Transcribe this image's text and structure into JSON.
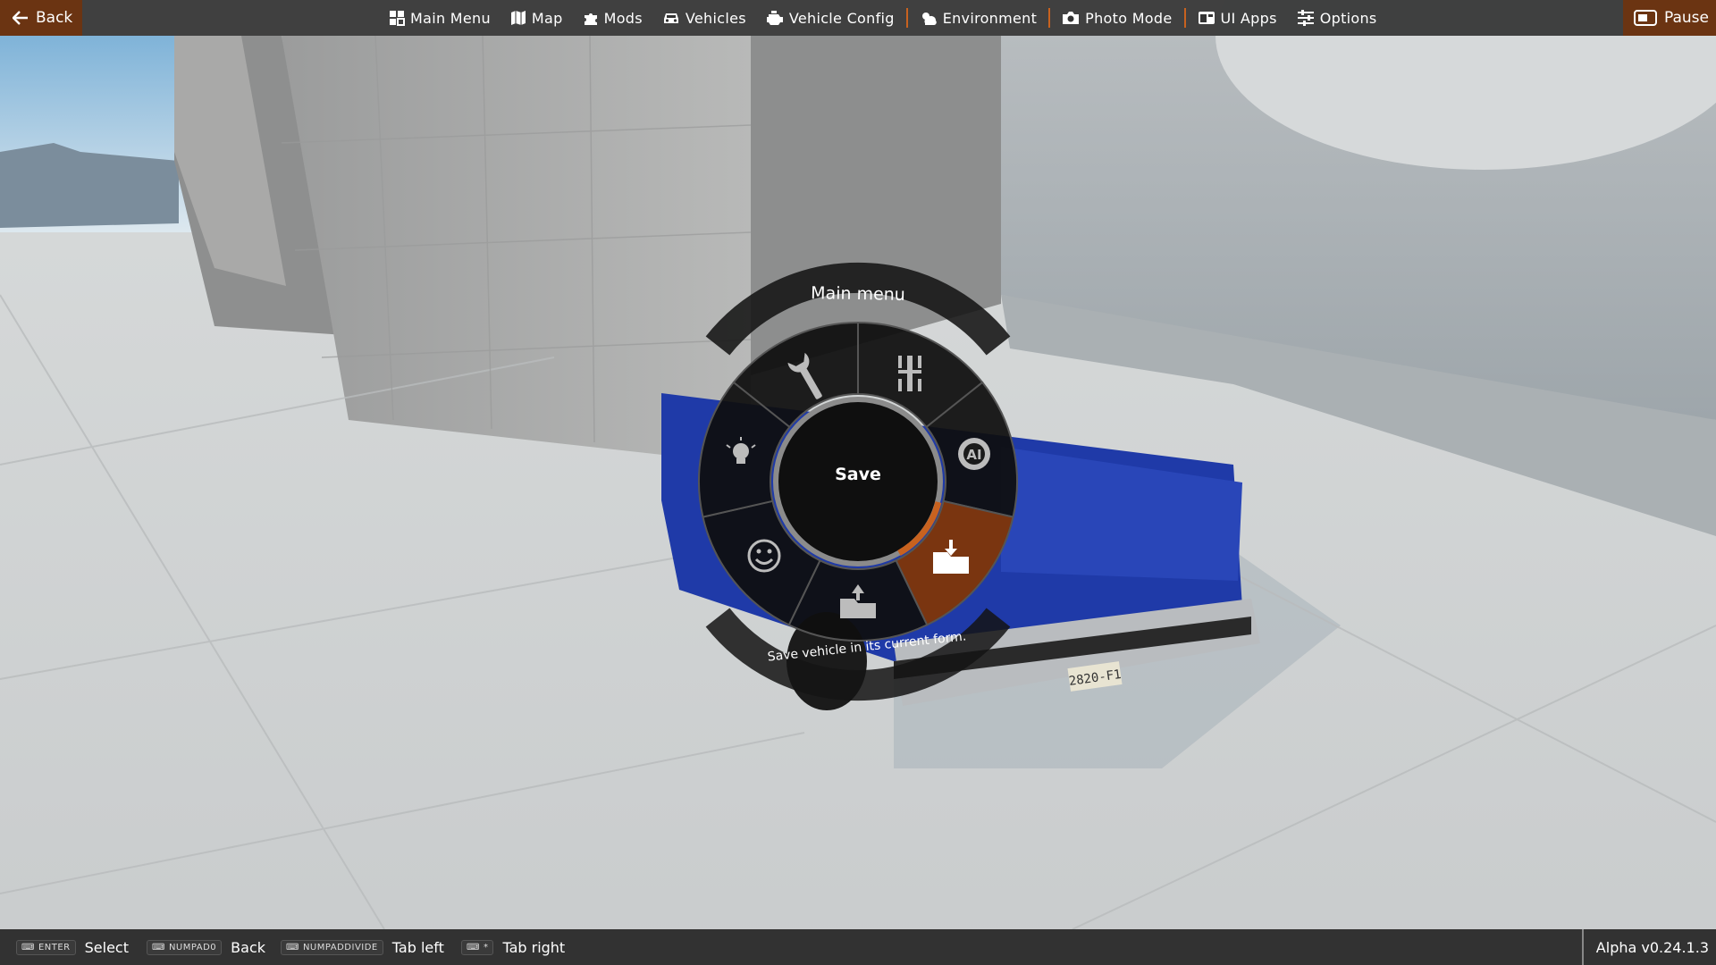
{
  "topbar": {
    "back_label": "Back",
    "pause_label": "Pause",
    "nav": [
      {
        "label": "Main Menu",
        "icon": "main-menu-icon"
      },
      {
        "label": "Map",
        "icon": "map-icon"
      },
      {
        "label": "Mods",
        "icon": "puzzle-icon"
      },
      {
        "label": "Vehicles",
        "icon": "car-icon"
      },
      {
        "label": "Vehicle Config",
        "icon": "engine-icon"
      },
      {
        "label": "Environment",
        "icon": "weather-icon"
      },
      {
        "label": "Photo Mode",
        "icon": "camera-icon"
      },
      {
        "label": "UI Apps",
        "icon": "ui-apps-icon"
      },
      {
        "label": "Options",
        "icon": "sliders-icon"
      }
    ]
  },
  "radial_menu": {
    "title": "Main menu",
    "center_label": "Save",
    "description": "Save vehicle in its current form.",
    "items": [
      {
        "icon": "wrench-icon",
        "selected": false
      },
      {
        "icon": "chassis-icon",
        "selected": false
      },
      {
        "icon": "ai-chip-icon",
        "selected": false
      },
      {
        "icon": "folder-save-icon",
        "selected": true
      },
      {
        "icon": "folder-load-icon",
        "selected": false
      },
      {
        "icon": "smiley-icon",
        "selected": false
      },
      {
        "icon": "lightbulb-icon",
        "selected": false
      }
    ],
    "accent_color": "#c8621f"
  },
  "bottombar": {
    "hints": [
      {
        "key": "ENTER",
        "label": "Select"
      },
      {
        "key": "NUMPAD0",
        "label": "Back"
      },
      {
        "key": "NUMPADDIVIDE",
        "label": "Tab left"
      },
      {
        "key": "*",
        "label": "Tab right"
      }
    ],
    "version": "Alpha v0.24.1.3"
  },
  "scene": {
    "license_plate": "2820-F1"
  },
  "colors": {
    "accent": "#c8621f",
    "back_bg": "#6b3412",
    "truck_blue": "#1f3aa8"
  }
}
